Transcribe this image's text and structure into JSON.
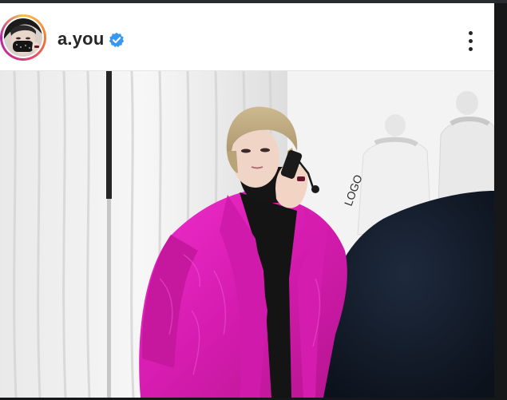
{
  "post": {
    "username": "a.you",
    "verified": true,
    "avatar_icon": "profile-avatar",
    "verified_icon": "verified-badge-icon",
    "more_icon": "more-options-icon"
  },
  "colors": {
    "verified_blue": "#3897f0",
    "coat_pink": "#e020b8",
    "text": "#262626"
  }
}
